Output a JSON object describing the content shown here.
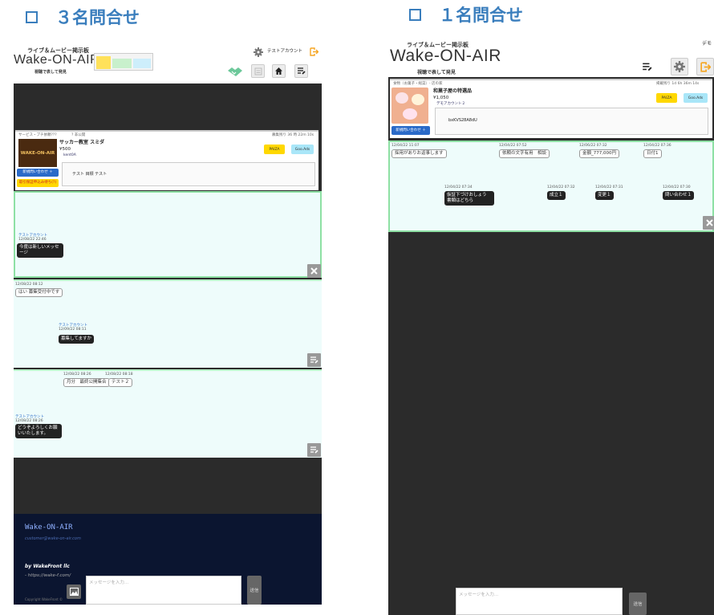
{
  "headings": {
    "left": "３名問合せ",
    "right": "１名問合せ"
  },
  "app": {
    "tagline": "ライブ＆ムービー掲示板",
    "brand": "Wake-ON-AIR",
    "subtitle": "視聴で表して発見",
    "account": "テストアカウント",
    "account_right": "デモ"
  },
  "left": {
    "post": {
      "category": "サービス・プチ依頼???",
      "flag": "? 非公開",
      "deadline": "募集残り 36 時 22m 10s",
      "title": "サッカー教室 スミダ",
      "price": "¥500",
      "owner": "kent0A",
      "thumb_text": "WAKE-ON-AIR",
      "new_inquiry": "新規問い合わせ ＋",
      "pending": "取引保証申込み待ち(?)",
      "memo": "テスト 目標 テスト",
      "btn_yellow": "PAIZA",
      "btn_blue": "Goo.Ads"
    },
    "thread1": {
      "user": "テストアカウント",
      "time": "12/08/22 22:46",
      "message": "今度は新しいメッセージ"
    },
    "thread2": {
      "time_top": "12/08/22 08:12",
      "msg_top": "はい 募集受付中です",
      "user": "テストアカウント",
      "time": "12/09/22 08:11",
      "message": "募集してますか"
    },
    "thread3": {
      "t1": "12/08/22 08:26",
      "t2": "12/08/22 08:18",
      "c1": "月分　最終公開集合",
      "c2": "テスト２",
      "user": "テストアカウント",
      "time": "12/08/22 08:26",
      "message": "どうぞよろしくお願いいたします。"
    },
    "footer": {
      "brand": "Wake-ON-AIR",
      "email": "customer@wake-on-air.com",
      "by": "by WakeFront llc",
      "url": "- https://wake-f.com/",
      "copyright": "Copyright WakeFront ©"
    },
    "input_placeholder": "メッセージを入力...",
    "send": "送信"
  },
  "right": {
    "post": {
      "category": "食物（お菓子・総菜）- 店の家",
      "deadline": "掲載残り 1d 6h 36m 14s",
      "title": "和菓子屋の特選品",
      "price": "¥1,050",
      "owner": "デモアカウント２",
      "new_inquiry": "新規問い合わせ ＋",
      "memo": "bxKVS28A8dU",
      "btn_yellow": "PAIZA",
      "btn_blue": "Goo.Ads"
    },
    "thread": {
      "r1t1": "12/04/22 11:07",
      "r1m1": "採用がありお返事します",
      "r1t2": "12/04/22 07:52",
      "r1m2": "依頼の文字有用　相談",
      "r1t3": "12/06/22 07:32",
      "r1m3": "金額_777,000円",
      "r1t4": "12/04/22 07:36",
      "r1m4": "日付1",
      "r2t1": "12/04/22 07:34",
      "r2m1": "仮証下づけおしょう\n書類はどちら",
      "r2t2": "12/04/22 07:32",
      "r2m2": "成立１",
      "r2t3": "12/04/22 07:31",
      "r2m3": "変更１",
      "r2t4": "12/04/22 07:30",
      "r2m4": "問い合わせ１"
    },
    "input_placeholder": "メッセージを入力...",
    "send": "送信"
  },
  "colors": {
    "heading": "#3a7ebd",
    "thread_bg": "#eefcfb",
    "thread_border": "#b8f0c8",
    "logout": "#f5a623",
    "footer_bg": "#0b1530"
  },
  "icons": [
    "gear-icon",
    "logout-icon",
    "handshake-icon",
    "list-icon",
    "home-icon",
    "filter-icon",
    "delete-icon",
    "image-icon"
  ]
}
